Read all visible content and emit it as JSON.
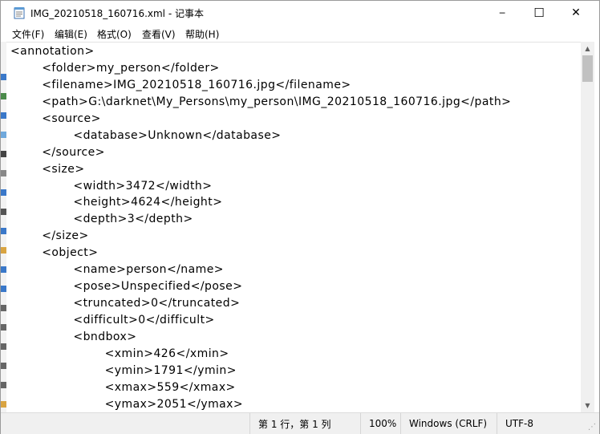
{
  "window": {
    "title": "IMG_20210518_160716.xml - 记事本",
    "minimize_glyph": "─",
    "maximize_glyph": "☐",
    "close_glyph": "✕"
  },
  "menu": {
    "items": [
      "文件(F)",
      "编辑(E)",
      "格式(O)",
      "查看(V)",
      "帮助(H)"
    ]
  },
  "editor": {
    "lines": [
      "<annotation>",
      "        <folder>my_person</folder>",
      "        <filename>IMG_20210518_160716.jpg</filename>",
      "        <path>G:\\darknet\\My_Persons\\my_person\\IMG_20210518_160716.jpg</path>",
      "        <source>",
      "                <database>Unknown</database>",
      "        </source>",
      "        <size>",
      "                <width>3472</width>",
      "                <height>4624</height>",
      "                <depth>3</depth>",
      "        </size>",
      "        <object>",
      "                <name>person</name>",
      "                <pose>Unspecified</pose>",
      "                <truncated>0</truncated>",
      "                <difficult>0</difficult>",
      "                <bndbox>",
      "                        <xmin>426</xmin>",
      "                        <ymin>1791</ymin>",
      "                        <xmax>559</xmax>",
      "                        <ymax>2051</ymax>"
    ]
  },
  "statusbar": {
    "position": "第 1 行，第 1 列",
    "zoom": "100%",
    "line_ending": "Windows (CRLF)",
    "encoding": "UTF-8"
  },
  "colors": {
    "window_bg": "#ffffff",
    "statusbar_bg": "#f0f0f0",
    "scroll_thumb": "#c1c1c1"
  }
}
